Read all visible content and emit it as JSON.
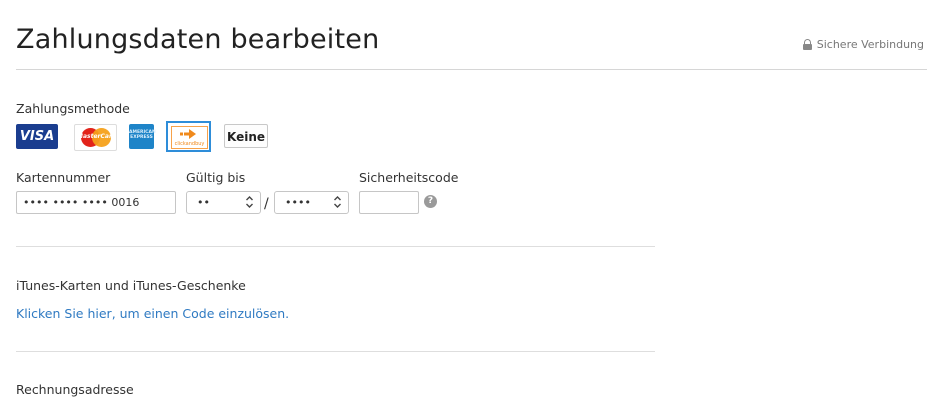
{
  "header": {
    "title": "Zahlungsdaten bearbeiten",
    "secure_label": "Sichere Verbindung"
  },
  "payment": {
    "method_label": "Zahlungsmethode",
    "methods": [
      {
        "name": "VISA",
        "icon": "visa-card-icon"
      },
      {
        "name": "MasterCard",
        "icon": "mastercard-card-icon"
      },
      {
        "name": "AMERICAN EXPRESS",
        "icon": "amex-card-icon"
      },
      {
        "name": "clickandbuy",
        "icon": "clickandbuy-icon",
        "selected": true
      },
      {
        "name": "Keine",
        "icon": "none-button"
      }
    ],
    "card_number_label": "Kartennummer",
    "card_number_value": "•••• •••• •••• 0016",
    "expiry_label": "Gültig bis",
    "expiry_month": "••",
    "expiry_separator": "/",
    "expiry_year": "••••",
    "security_code_label": "Sicherheitscode",
    "security_code_value": "",
    "help_glyph": "?"
  },
  "gift": {
    "heading": "iTunes-Karten und iTunes-Geschenke",
    "redeem_link": "Klicken Sie hier, um einen Code einzulösen."
  },
  "billing": {
    "heading": "Rechnungsadresse"
  },
  "colors": {
    "link": "#2f7ac2",
    "visa": "#1a3d8f",
    "selected_border": "#2e8dd9",
    "clickandbuy_orange": "#f08a1c"
  }
}
